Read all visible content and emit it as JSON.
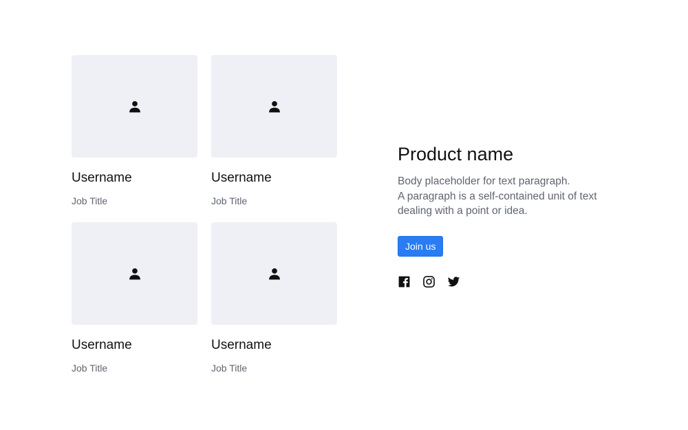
{
  "team": {
    "members": [
      {
        "username": "Username",
        "job_title": "Job Title",
        "icon": "user-icon"
      },
      {
        "username": "Username",
        "job_title": "Job Title",
        "icon": "user-icon"
      },
      {
        "username": "Username",
        "job_title": "Job Title",
        "icon": "user-icon"
      },
      {
        "username": "Username",
        "job_title": "Job Title",
        "icon": "user-icon"
      }
    ]
  },
  "product": {
    "name": "Product name",
    "body_lines": [
      "Body placeholder for text paragraph.",
      "A paragraph is a self-contained unit of text",
      "dealing with a point or idea."
    ],
    "cta_label": "Join us"
  },
  "social": {
    "icons": [
      "facebook-icon",
      "instagram-icon",
      "twitter-icon"
    ]
  },
  "colors": {
    "accent": "#2a7cf4",
    "placeholder_bg": "#eff0f5",
    "muted_text": "#5f6470"
  }
}
